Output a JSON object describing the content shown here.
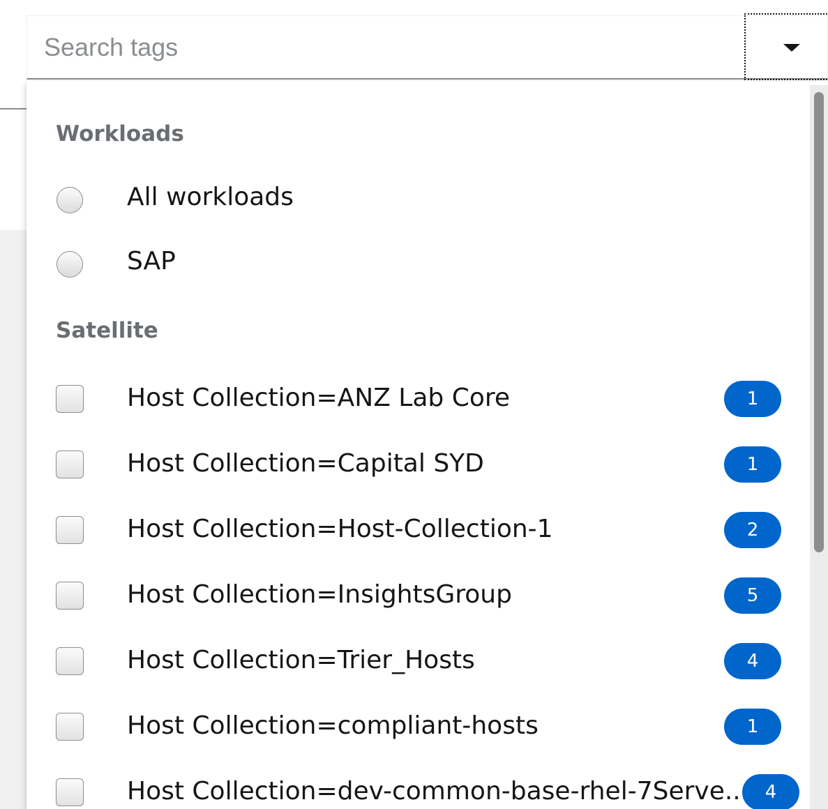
{
  "search": {
    "placeholder": "Search tags",
    "value": ""
  },
  "menu": {
    "workloads_title": "Workloads",
    "workloads": [
      {
        "label": "All workloads",
        "selected": false
      },
      {
        "label": "SAP",
        "selected": false
      }
    ],
    "satellite_title": "Satellite",
    "satellite": [
      {
        "label": "Host Collection=ANZ Lab Core",
        "count": "1",
        "checked": false
      },
      {
        "label": "Host Collection=Capital SYD",
        "count": "1",
        "checked": false
      },
      {
        "label": "Host Collection=Host-Collection-1",
        "count": "2",
        "checked": false
      },
      {
        "label": "Host Collection=InsightsGroup",
        "count": "5",
        "checked": false
      },
      {
        "label": "Host Collection=Trier_Hosts",
        "count": "4",
        "checked": false
      },
      {
        "label": "Host Collection=compliant-hosts",
        "count": "1",
        "checked": false
      },
      {
        "label": "Host Collection=dev-common-base-rhel-7Serve...",
        "count": "4",
        "checked": false
      }
    ]
  },
  "colors": {
    "badge": "#0066cc",
    "group_title": "#6a6e73",
    "text": "#151515",
    "placeholder": "#8a8d90"
  },
  "icons": {
    "toggle": "caret-down-icon"
  }
}
